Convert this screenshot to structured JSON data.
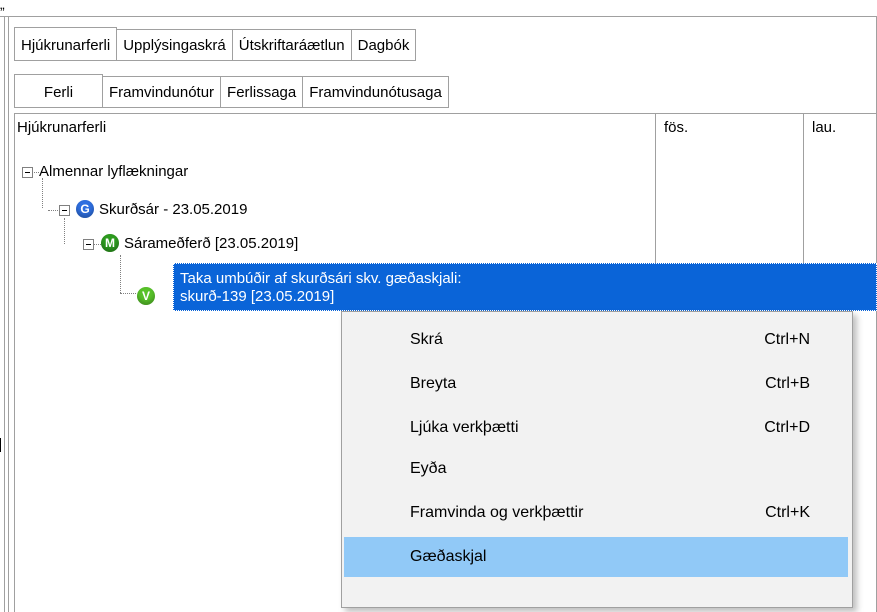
{
  "window": {
    "top_glyph": "„"
  },
  "main_tabs": [
    {
      "label": "Hjúkrunarferli",
      "active": true
    },
    {
      "label": "Upplýsingaskrá",
      "active": false
    },
    {
      "label": "Útskriftaráætlun",
      "active": false
    },
    {
      "label": "Dagbók",
      "active": false
    }
  ],
  "sub_tabs": [
    {
      "label": "Ferli",
      "active": true
    },
    {
      "label": "Framvindunótur",
      "active": false
    },
    {
      "label": "Ferlissaga",
      "active": false
    },
    {
      "label": "Framvindunótusaga",
      "active": false
    }
  ],
  "columns": [
    "Hjúkrunarferli",
    "fös.",
    "lau."
  ],
  "tree": {
    "root": "Almennar lyflækningar",
    "level1": {
      "badge": "G",
      "label": "Skurðsár - 23.05.2019"
    },
    "level2": {
      "badge": "M",
      "label": "Sárameðferð [23.05.2019]"
    },
    "level3": {
      "badge": "V",
      "line1": "Taka umbúðir af skurðsári skv. gæðaskjali:",
      "line2": "skurð-139 [23.05.2019]"
    }
  },
  "context_menu": [
    {
      "label": "Skrá",
      "shortcut": "Ctrl+N"
    },
    {
      "label": "Breyta",
      "shortcut": "Ctrl+B"
    },
    {
      "label": "Ljúka verkþætti",
      "shortcut": "Ctrl+D"
    },
    {
      "label": "Eyða",
      "shortcut": ""
    },
    {
      "label": "Framvinda og verkþættir",
      "shortcut": "Ctrl+K"
    },
    {
      "label": "Gæðaskjal",
      "shortcut": "",
      "highlighted": true
    }
  ],
  "colors": {
    "selection": "#0a64d8",
    "menu_highlight": "#91c9f7",
    "menu_bg": "#f2f2f2"
  }
}
